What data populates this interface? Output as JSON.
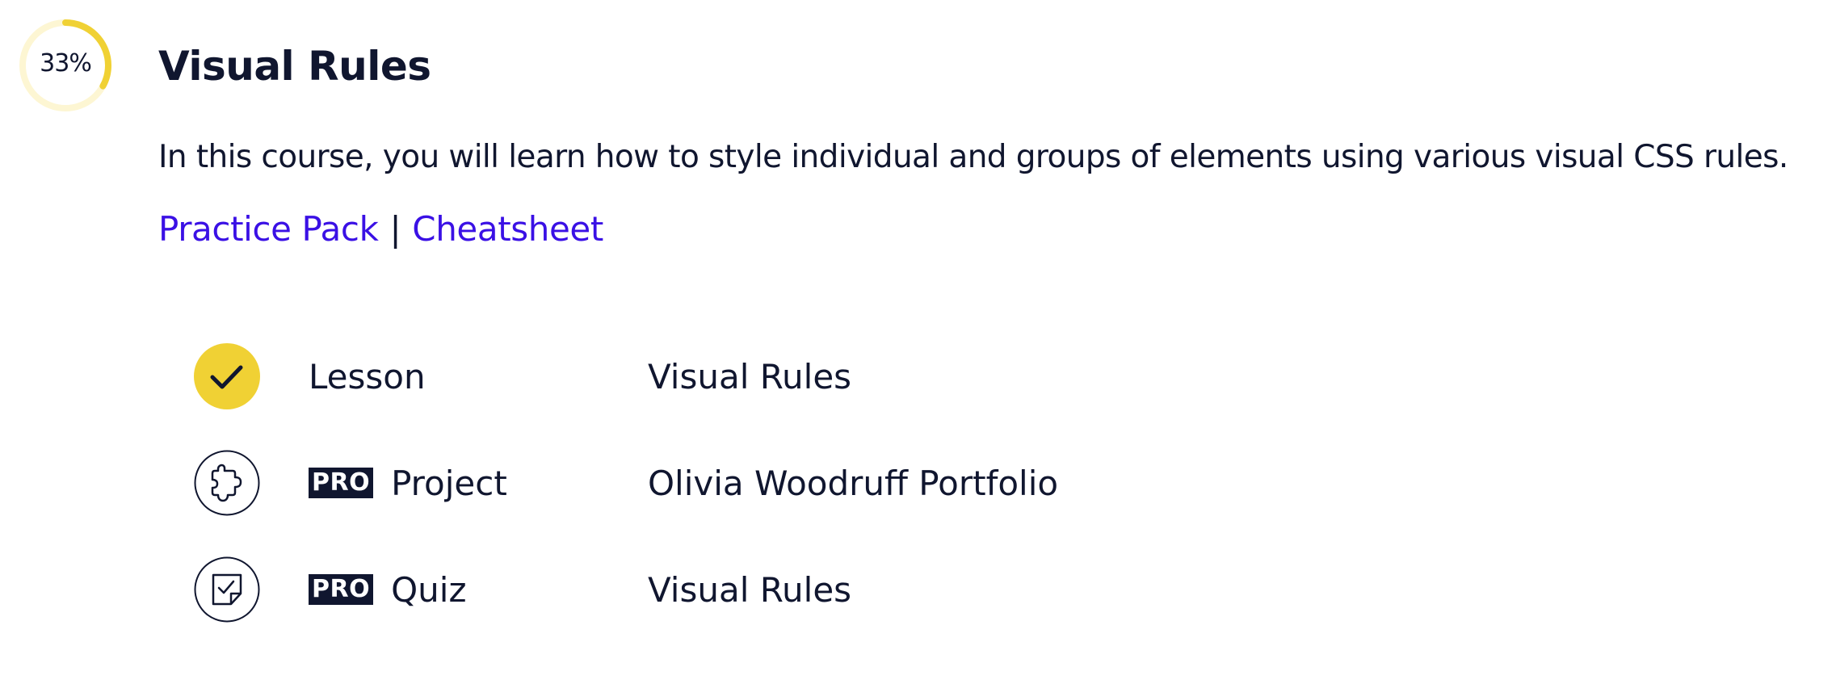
{
  "progress": {
    "percent": 33,
    "label": "33%",
    "color": "#f0d134",
    "track_color": "#fdf6d3"
  },
  "header": {
    "title": "Visual Rules",
    "description": "In this course, you will learn how to style individual and groups of elements using various visual CSS rules."
  },
  "links": {
    "practice_pack": "Practice Pack",
    "separator": "|",
    "cheatsheet": "Cheatsheet",
    "color": "#3a10e5"
  },
  "items": [
    {
      "icon": "check-icon",
      "status": "completed",
      "pro": false,
      "type": "Lesson",
      "name": "Visual Rules"
    },
    {
      "icon": "puzzle-icon",
      "status": "not-started",
      "pro": true,
      "pro_label": "PRO",
      "type": "Project",
      "name": "Olivia Woodruff Portfolio"
    },
    {
      "icon": "quiz-icon",
      "status": "not-started",
      "pro": true,
      "pro_label": "PRO",
      "type": "Quiz",
      "name": "Visual Rules"
    }
  ]
}
